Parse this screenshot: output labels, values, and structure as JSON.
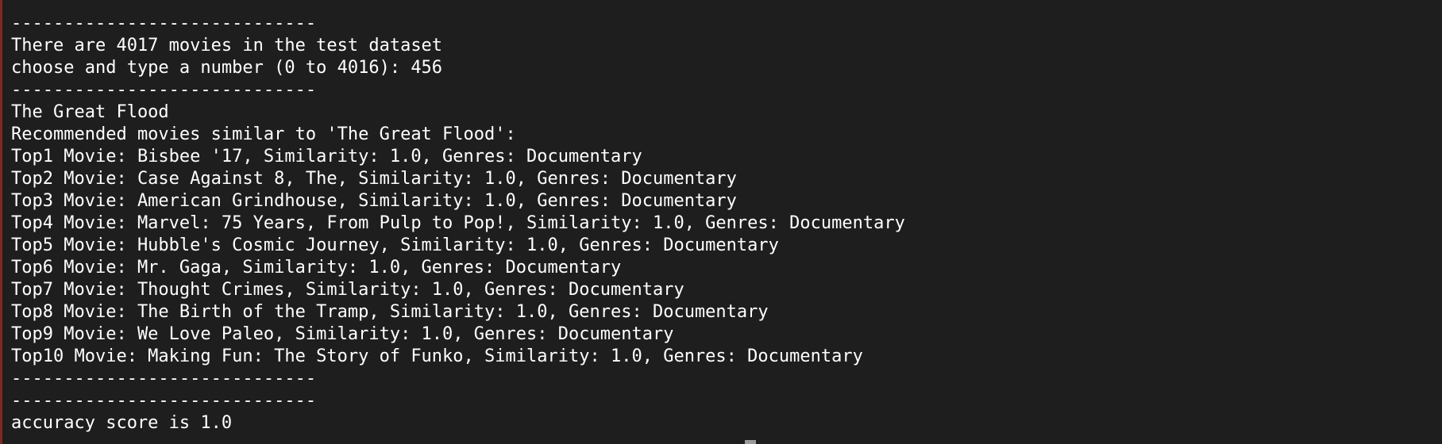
{
  "terminal": {
    "lines": [
      "-----------------------------",
      "There are 4017 movies in the test dataset",
      "choose and type a number (0 to 4016): 456",
      "-----------------------------",
      "The Great Flood",
      "Recommended movies similar to 'The Great Flood':",
      "Top1 Movie: Bisbee '17, Similarity: 1.0, Genres: Documentary",
      "Top2 Movie: Case Against 8, The, Similarity: 1.0, Genres: Documentary",
      "Top3 Movie: American Grindhouse, Similarity: 1.0, Genres: Documentary",
      "Top4 Movie: Marvel: 75 Years, From Pulp to Pop!, Similarity: 1.0, Genres: Documentary",
      "Top5 Movie: Hubble's Cosmic Journey, Similarity: 1.0, Genres: Documentary",
      "Top6 Movie: Mr. Gaga, Similarity: 1.0, Genres: Documentary",
      "Top7 Movie: Thought Crimes, Similarity: 1.0, Genres: Documentary",
      "Top8 Movie: The Birth of the Tramp, Similarity: 1.0, Genres: Documentary",
      "Top9 Movie: We Love Paleo, Similarity: 1.0, Genres: Documentary",
      "Top10 Movie: Making Fun: The Story of Funko, Similarity: 1.0, Genres: Documentary",
      "-----------------------------",
      "-----------------------------",
      "accuracy score is 1.0"
    ]
  },
  "colors": {
    "background": "#1e1e1e",
    "text": "#ffffff",
    "left_edge": "#7a2c22"
  }
}
